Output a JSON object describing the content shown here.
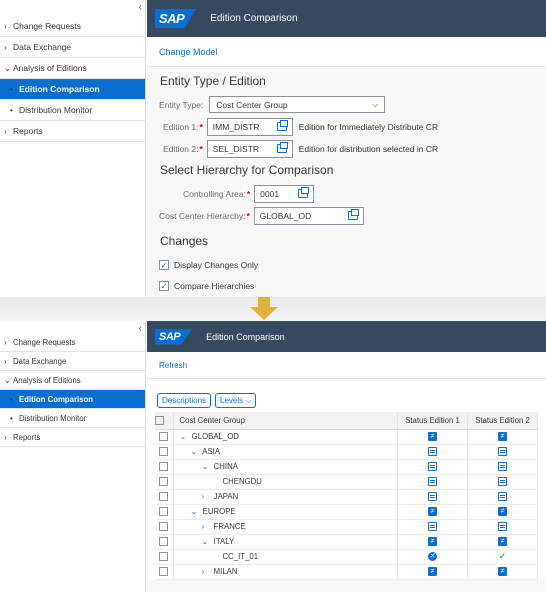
{
  "app_title": "Edition Comparison",
  "logo": "SAP",
  "nav": {
    "items": [
      "Change Requests",
      "Data Exchange",
      "Analysis of Editions",
      "Edition Comparison",
      "Distribution Monitor",
      "Reports"
    ],
    "selected": "Edition Comparison"
  },
  "top": {
    "toolbar_action": "Change Model",
    "section_entity": "Entity Type / Edition",
    "entity_type_label": "Entity Type:",
    "entity_type_value": "Cost Center Group",
    "edition1_label": "Edition 1:",
    "edition1_value": "IMM_DISTR",
    "edition1_desc": "Edition for Immediately Distribute CR",
    "edition2_label": "Edition 2:",
    "edition2_value": "SEL_DISTR",
    "edition2_desc": "Edition for distribution selected in CR",
    "section_hierarchy": "Select Hierarchy for Comparison",
    "controlling_area_label": "Controlling Area:",
    "controlling_area_value": "0001",
    "hierarchy_label": "Cost Center Hierarchy:",
    "hierarchy_value": "GLOBAL_OD",
    "section_changes": "Changes",
    "check1": "Display Changes Only",
    "check2": "Compare Hierarchies"
  },
  "bottom": {
    "toolbar_action": "Refresh",
    "btn_descriptions": "Descriptions",
    "btn_levels": "Levels",
    "columns": [
      "Cost Center Group",
      "Status Edition 1",
      "Status Edition 2"
    ],
    "rows": [
      {
        "label": "GLOBAL_OD",
        "indent": 0,
        "chev": "v",
        "s1": "ne",
        "s2": "ne"
      },
      {
        "label": "ASIA",
        "indent": 1,
        "chev": "v",
        "s1": "eq",
        "s2": "eq"
      },
      {
        "label": "CHINA",
        "indent": 2,
        "chev": "v",
        "s1": "eq",
        "s2": "eq"
      },
      {
        "label": "CHENGDU",
        "indent": 3,
        "chev": "",
        "s1": "eq",
        "s2": "eq"
      },
      {
        "label": "JAPAN",
        "indent": 2,
        "chev": ">",
        "s1": "eq",
        "s2": "eq"
      },
      {
        "label": "EUROPE",
        "indent": 1,
        "chev": "v",
        "s1": "ne",
        "s2": "ne"
      },
      {
        "label": "FRANCE",
        "indent": 2,
        "chev": ">",
        "s1": "eq",
        "s2": "eq"
      },
      {
        "label": "ITALY",
        "indent": 2,
        "chev": "v",
        "s1": "ne",
        "s2": "ne"
      },
      {
        "label": "CC_IT_01",
        "indent": 3,
        "chev": "",
        "s1": "x",
        "s2": "ok"
      },
      {
        "label": "MILAN",
        "indent": 2,
        "chev": ">",
        "s1": "ne",
        "s2": "ne"
      }
    ]
  },
  "colors": {
    "shell": "#354a5f",
    "accent": "#0a6ed1",
    "arrow": "#e2b33c"
  }
}
